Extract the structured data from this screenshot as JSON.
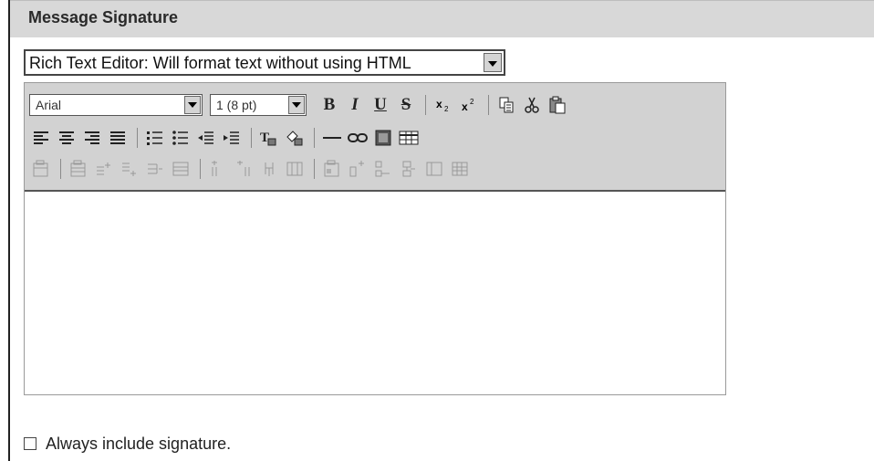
{
  "header": {
    "title": "Message Signature"
  },
  "editor_mode": {
    "selected": "Rich Text Editor: Will format text without using HTML"
  },
  "toolbar": {
    "font_family": "Arial",
    "font_size": "1 (8 pt)",
    "bold_label": "B",
    "italic_label": "I",
    "underline_label": "U",
    "strike_label": "S",
    "icons": [
      "subscript-icon",
      "superscript-icon",
      "copy-icon",
      "cut-icon",
      "paste-icon",
      "align-left-icon",
      "align-center-icon",
      "align-right-icon",
      "justify-icon",
      "numbered-list-icon",
      "bulleted-list-icon",
      "outdent-icon",
      "indent-icon",
      "text-color-icon",
      "highlight-color-icon",
      "horizontal-rule-icon",
      "link-icon",
      "image-icon",
      "table-icon"
    ]
  },
  "editor": {
    "content": ""
  },
  "signature_option": {
    "label": "Always include signature.",
    "checked": false
  }
}
